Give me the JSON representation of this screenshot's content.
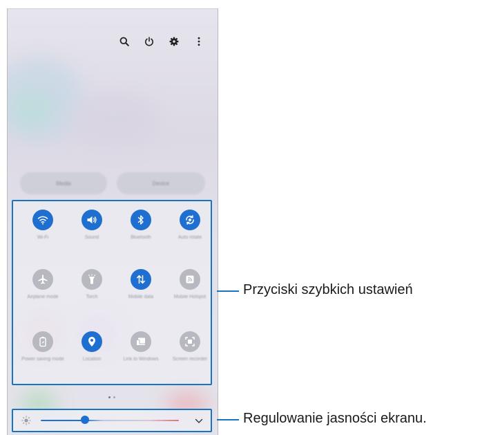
{
  "quick_settings": {
    "top_icons": [
      "search-icon",
      "power-icon",
      "gear-icon",
      "more-vertical-icon"
    ],
    "media_buttons": [
      "Media",
      "Device"
    ],
    "tiles": [
      {
        "label": "Wi-Fi",
        "icon": "wifi-icon",
        "active": true
      },
      {
        "label": "Sound",
        "icon": "sound-icon",
        "active": true
      },
      {
        "label": "Bluetooth",
        "icon": "bluetooth-icon",
        "active": true
      },
      {
        "label": "Auto rotate",
        "icon": "auto-rotate-icon",
        "active": true
      },
      {
        "label": "Airplane mode",
        "icon": "airplane-icon",
        "active": false
      },
      {
        "label": "Torch",
        "icon": "flashlight-icon",
        "active": false
      },
      {
        "label": "Mobile data",
        "icon": "mobile-data-icon",
        "active": true
      },
      {
        "label": "Mobile Hotspot",
        "icon": "hotspot-icon",
        "active": false
      },
      {
        "label": "Power saving mode",
        "icon": "battery-saver-icon",
        "active": false
      },
      {
        "label": "Location",
        "icon": "location-icon",
        "active": true
      },
      {
        "label": "Link to Windows",
        "icon": "link-windows-icon",
        "active": false
      },
      {
        "label": "Screen recorder",
        "icon": "screen-recorder-icon",
        "active": false
      }
    ],
    "brightness": {
      "level": 0.32
    }
  },
  "callouts": {
    "quick_buttons": "Przyciski szybkich ustawień",
    "brightness": "Regulowanie jasności ekranu."
  },
  "colors": {
    "accent": "#1f6fd0",
    "callout_blue": "#1a73c1",
    "inactive": "#b8b8c0"
  }
}
